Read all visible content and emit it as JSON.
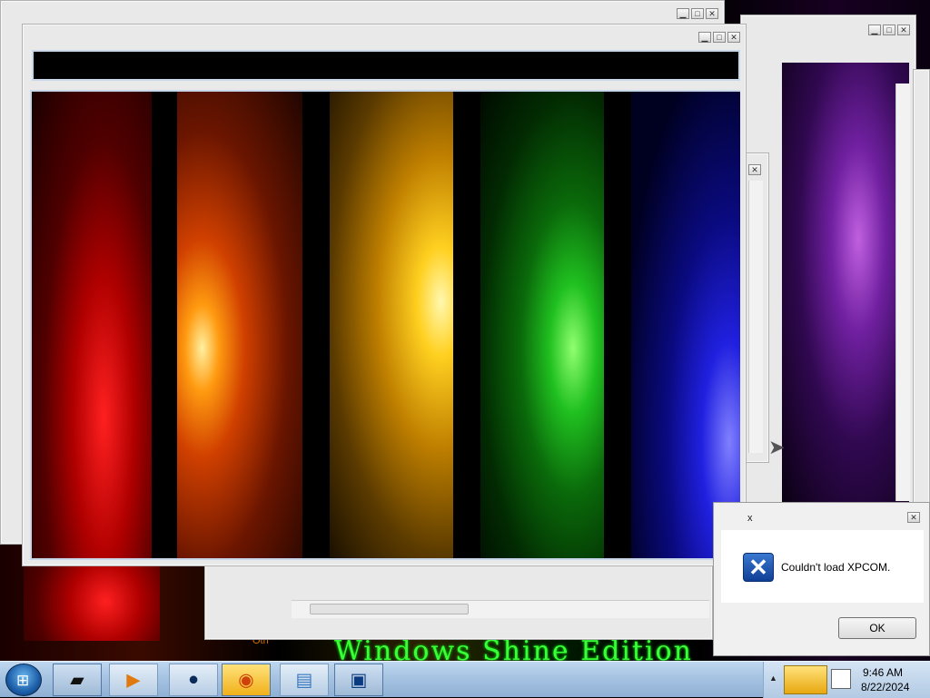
{
  "desktop": {
    "wallpaper_text": "Windows Shine Edition",
    "wallpaper_small": "Otri"
  },
  "window_controls": {
    "minimize": "▁",
    "maximize": "□",
    "close": "✕"
  },
  "dialog": {
    "title": "x",
    "message": "Couldn't load XPCOM.",
    "ok_label": "OK",
    "close": "✕"
  },
  "taskbar": {
    "start_glyph": "⊞",
    "items": [
      {
        "name": "folder-dark",
        "glyph": "▰"
      },
      {
        "name": "media-player",
        "glyph": "▶"
      },
      {
        "name": "globe",
        "glyph": "●"
      },
      {
        "name": "firefox",
        "glyph": "◉"
      },
      {
        "name": "notes",
        "glyph": "▤"
      },
      {
        "name": "display",
        "glyph": "▣"
      }
    ],
    "tray": {
      "expand": "▲",
      "time": "9:46 AM",
      "date": "8/22/2024"
    }
  },
  "colors": {
    "taskbar": "#a6c3e2",
    "window_frame": "#e9e9e9",
    "dialog_icon": "#1f57b6",
    "wallpaper_text": "#38ff38"
  }
}
